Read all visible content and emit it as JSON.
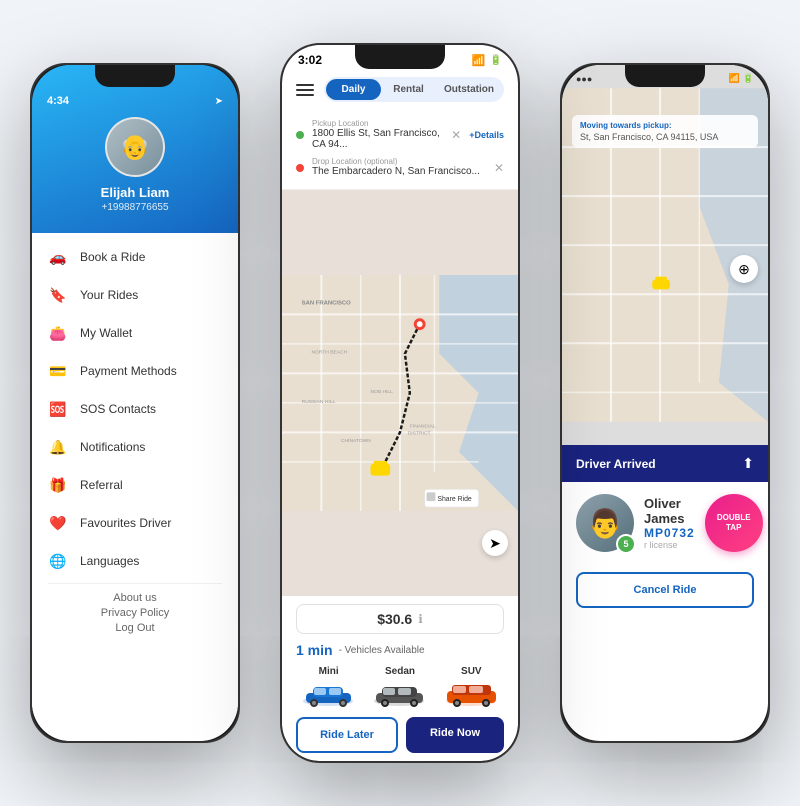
{
  "left_phone": {
    "status_time": "4:34",
    "user_name": "Elijah Liam",
    "user_phone": "+19988776655",
    "menu_items": [
      {
        "icon": "🚗",
        "label": "Book a Ride"
      },
      {
        "icon": "📍",
        "label": "Your Rides"
      },
      {
        "icon": "👛",
        "label": "My Wallet"
      },
      {
        "icon": "💳",
        "label": "Payment Methods"
      },
      {
        "icon": "🆘",
        "label": "SOS Contacts"
      },
      {
        "icon": "🔔",
        "label": "Notifications"
      },
      {
        "icon": "🎁",
        "label": "Referral"
      },
      {
        "icon": "❤️",
        "label": "Favourites Driver"
      },
      {
        "icon": "🌐",
        "label": "Languages"
      }
    ],
    "footer_links": [
      "About us",
      "Privacy Policy",
      "Log Out"
    ]
  },
  "center_phone": {
    "status_time": "3:02",
    "tabs": [
      "Daily",
      "Rental",
      "Outstation"
    ],
    "active_tab": "Daily",
    "pickup_label": "Pickup Location",
    "pickup_value": "1800 Ellis St, San Francisco, CA 94...",
    "drop_label": "Drop Location (optional)",
    "drop_value": "The Embarcadero N, San Francisco...",
    "details_link": "+Details",
    "price": "$30.6",
    "eta": "1 min",
    "eta_label": "- Vehicles Available",
    "vehicles": [
      {
        "name": "Mini",
        "color": "#1565c0"
      },
      {
        "name": "Sedan",
        "color": "#444"
      },
      {
        "name": "SUV",
        "color": "#e65100"
      }
    ],
    "btn_later": "Ride Later",
    "btn_now": "Ride Now",
    "share_ride_label": "Share Ride"
  },
  "right_phone": {
    "moving_title": "Moving towards pickup:",
    "moving_address": "St, San Francisco, CA 94115, USA",
    "driver_arrived_label": "Driver Arrived",
    "driver_name": "Oliver James",
    "driver_plate": "MP0732",
    "driver_lic_label": "r license",
    "rating": "5",
    "double_tap_line1": "Double",
    "double_tap_line2": "Tap",
    "cancel_ride_label": "Cancel Ride"
  }
}
